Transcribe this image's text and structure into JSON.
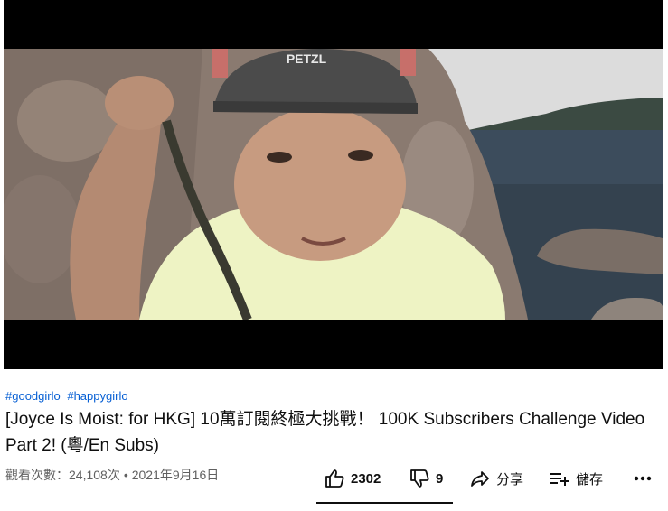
{
  "video": {
    "hashtags": [
      "#goodgirlo",
      "#happygirlo"
    ],
    "title": "[Joyce Is Moist: for HKG] 10萬訂閱終極大挑戰！ 100K Subscribers Challenge Video Part 2! (粵/En Subs)",
    "views": "觀看次數：24,108次",
    "separator": "•",
    "date": "2021年9月16日",
    "helmet_brand": "PETZL"
  },
  "actions": {
    "like_count": "2302",
    "dislike_count": "9",
    "share_label": "分享",
    "save_label": "儲存"
  },
  "icons": {
    "like": "thumb-up-icon",
    "dislike": "thumb-down-icon",
    "share": "share-arrow-icon",
    "save": "playlist-add-icon",
    "more": "more-horizontal-icon"
  },
  "colors": {
    "hashtag": "#065fd4",
    "meta": "#606060",
    "text": "#0f0f0f"
  }
}
